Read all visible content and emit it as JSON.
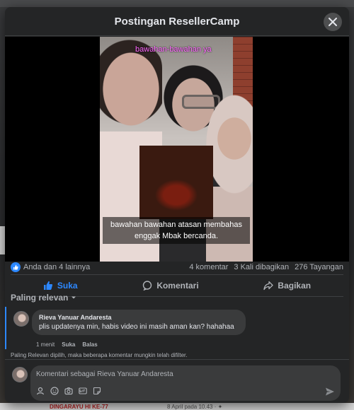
{
  "modal": {
    "title": "Postingan ResellerCamp"
  },
  "video": {
    "top_caption": "bawahan-bawahan ya",
    "subtitle": "bawahan bawahan atasan membahas enggak Mbak bercanda."
  },
  "stats": {
    "reactions": "Anda dan 4 lainnya",
    "comments": "4 komentar",
    "shares": "3 Kali dibagikan",
    "views": "276 Tayangan"
  },
  "actions": {
    "like": "Suka",
    "comment": "Komentari",
    "share": "Bagikan"
  },
  "sort": {
    "label": "Paling relevan"
  },
  "comment": {
    "author": "Rieva Yanuar Andaresta",
    "text": "plis updatenya min, habis video ini masih aman kan? hahahaa",
    "time": "1 menit",
    "like": "Suka",
    "reply": "Balas"
  },
  "filter_note": "Paling Relevan dipilih, maka beberapa komentar mungkin telah difilter.",
  "composer": {
    "placeholder": "Komentari sebagai Rieva Yanuar Andaresta"
  },
  "background": {
    "left_text": "DINGARAYU HI KE-77",
    "right_text": "8 April pada 10.43 · ✦"
  },
  "colors": {
    "modal_bg": "#242526",
    "accent": "#2d88ff",
    "bubble_bg": "#3a3b3c"
  }
}
